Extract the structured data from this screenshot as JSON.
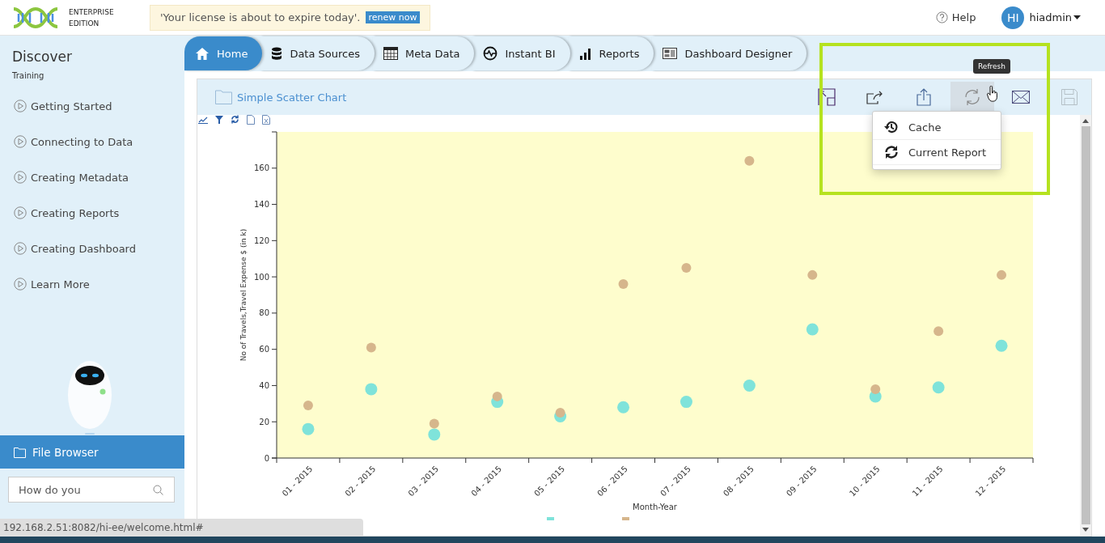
{
  "header": {
    "logo_lines": [
      "ENTERPRISE",
      "EDITION"
    ],
    "license_notice": "'Your license is about to expire today'.",
    "renew_link": "renew now",
    "help": "Help",
    "user": {
      "initials": "HI",
      "name": "hiadmin"
    }
  },
  "nav_tabs": [
    {
      "kind": "home",
      "label": "Home",
      "selected": true
    },
    {
      "kind": "database",
      "label": "Data Sources",
      "selected": false
    },
    {
      "kind": "table",
      "label": "Meta Data",
      "selected": false
    },
    {
      "kind": "pulse",
      "label": "Instant BI",
      "selected": false
    },
    {
      "kind": "bars",
      "label": "Reports",
      "selected": false
    },
    {
      "kind": "dashboard",
      "label": "Dashboard Designer",
      "selected": false
    }
  ],
  "sidebar": {
    "title": "Discover",
    "subtitle": "Training",
    "items": [
      "Getting Started",
      "Connecting to Data",
      "Creating Metadata",
      "Creating Reports",
      "Creating Dashboard",
      "Learn More"
    ],
    "file_browser": "File Browser",
    "search": {
      "placeholder": "How do you"
    }
  },
  "report": {
    "title": "Simple Scatter Chart",
    "actions": [
      {
        "kind": "expand",
        "hovered": false,
        "disabled": false
      },
      {
        "kind": "share",
        "hovered": false,
        "disabled": false
      },
      {
        "kind": "export",
        "hovered": false,
        "disabled": false
      },
      {
        "kind": "refresh",
        "hovered": true,
        "disabled": false
      },
      {
        "kind": "email",
        "hovered": false,
        "disabled": false
      },
      {
        "kind": "save",
        "hovered": false,
        "disabled": true
      }
    ],
    "tooltip": "Refresh",
    "refresh_menu": [
      {
        "kind": "history",
        "label": "Cache"
      },
      {
        "kind": "sync",
        "label": "Current Report"
      }
    ],
    "chart_data": {
      "type": "scatter",
      "xlabel": "Month-Year",
      "ylabel": "No of Travels,Travel Expense $ (in k)",
      "categories": [
        "01 - 2015",
        "02 - 2015",
        "03 - 2015",
        "04 - 2015",
        "05 - 2015",
        "06 - 2015",
        "07 - 2015",
        "08 - 2015",
        "09 - 2015",
        "10 - 2015",
        "11 - 2015",
        "12 - 2015"
      ],
      "series": [
        {
          "color": "#7fe3da",
          "values": [
            16,
            38,
            13,
            31,
            23,
            28,
            31,
            40,
            71,
            34,
            39,
            62
          ]
        },
        {
          "color": "#d6b68c",
          "values": [
            29,
            61,
            19,
            34,
            25,
            96,
            105,
            164,
            101,
            38,
            70,
            101
          ]
        }
      ],
      "ylim": [
        0,
        180
      ],
      "yticks": [
        0,
        20,
        40,
        60,
        80,
        100,
        120,
        140,
        160
      ]
    }
  },
  "status_bar": "192.168.2.51:8082/hi-ee/welcome.html#"
}
